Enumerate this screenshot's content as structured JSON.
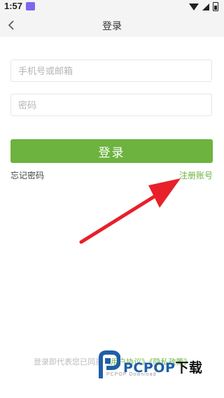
{
  "status_bar": {
    "time": "1:57"
  },
  "header": {
    "title": "登录"
  },
  "form": {
    "phone_placeholder": "手机号或邮箱",
    "password_placeholder": "密码",
    "login_label": "登录",
    "forgot_label": "忘记密码",
    "register_label": "注册账号"
  },
  "footer": {
    "agreement_prefix": "登录即代表您已同意",
    "user_agreement": "《用户协议》",
    "privacy_policy": "《隐私政策》"
  },
  "watermark": {
    "brand": "PCPOP",
    "suffix": "下载",
    "sub": "PCPOP Download"
  },
  "colors": {
    "accent": "#6cb33f",
    "arrow": "#e8202a",
    "watermark_blue": "#1f5fa8"
  }
}
